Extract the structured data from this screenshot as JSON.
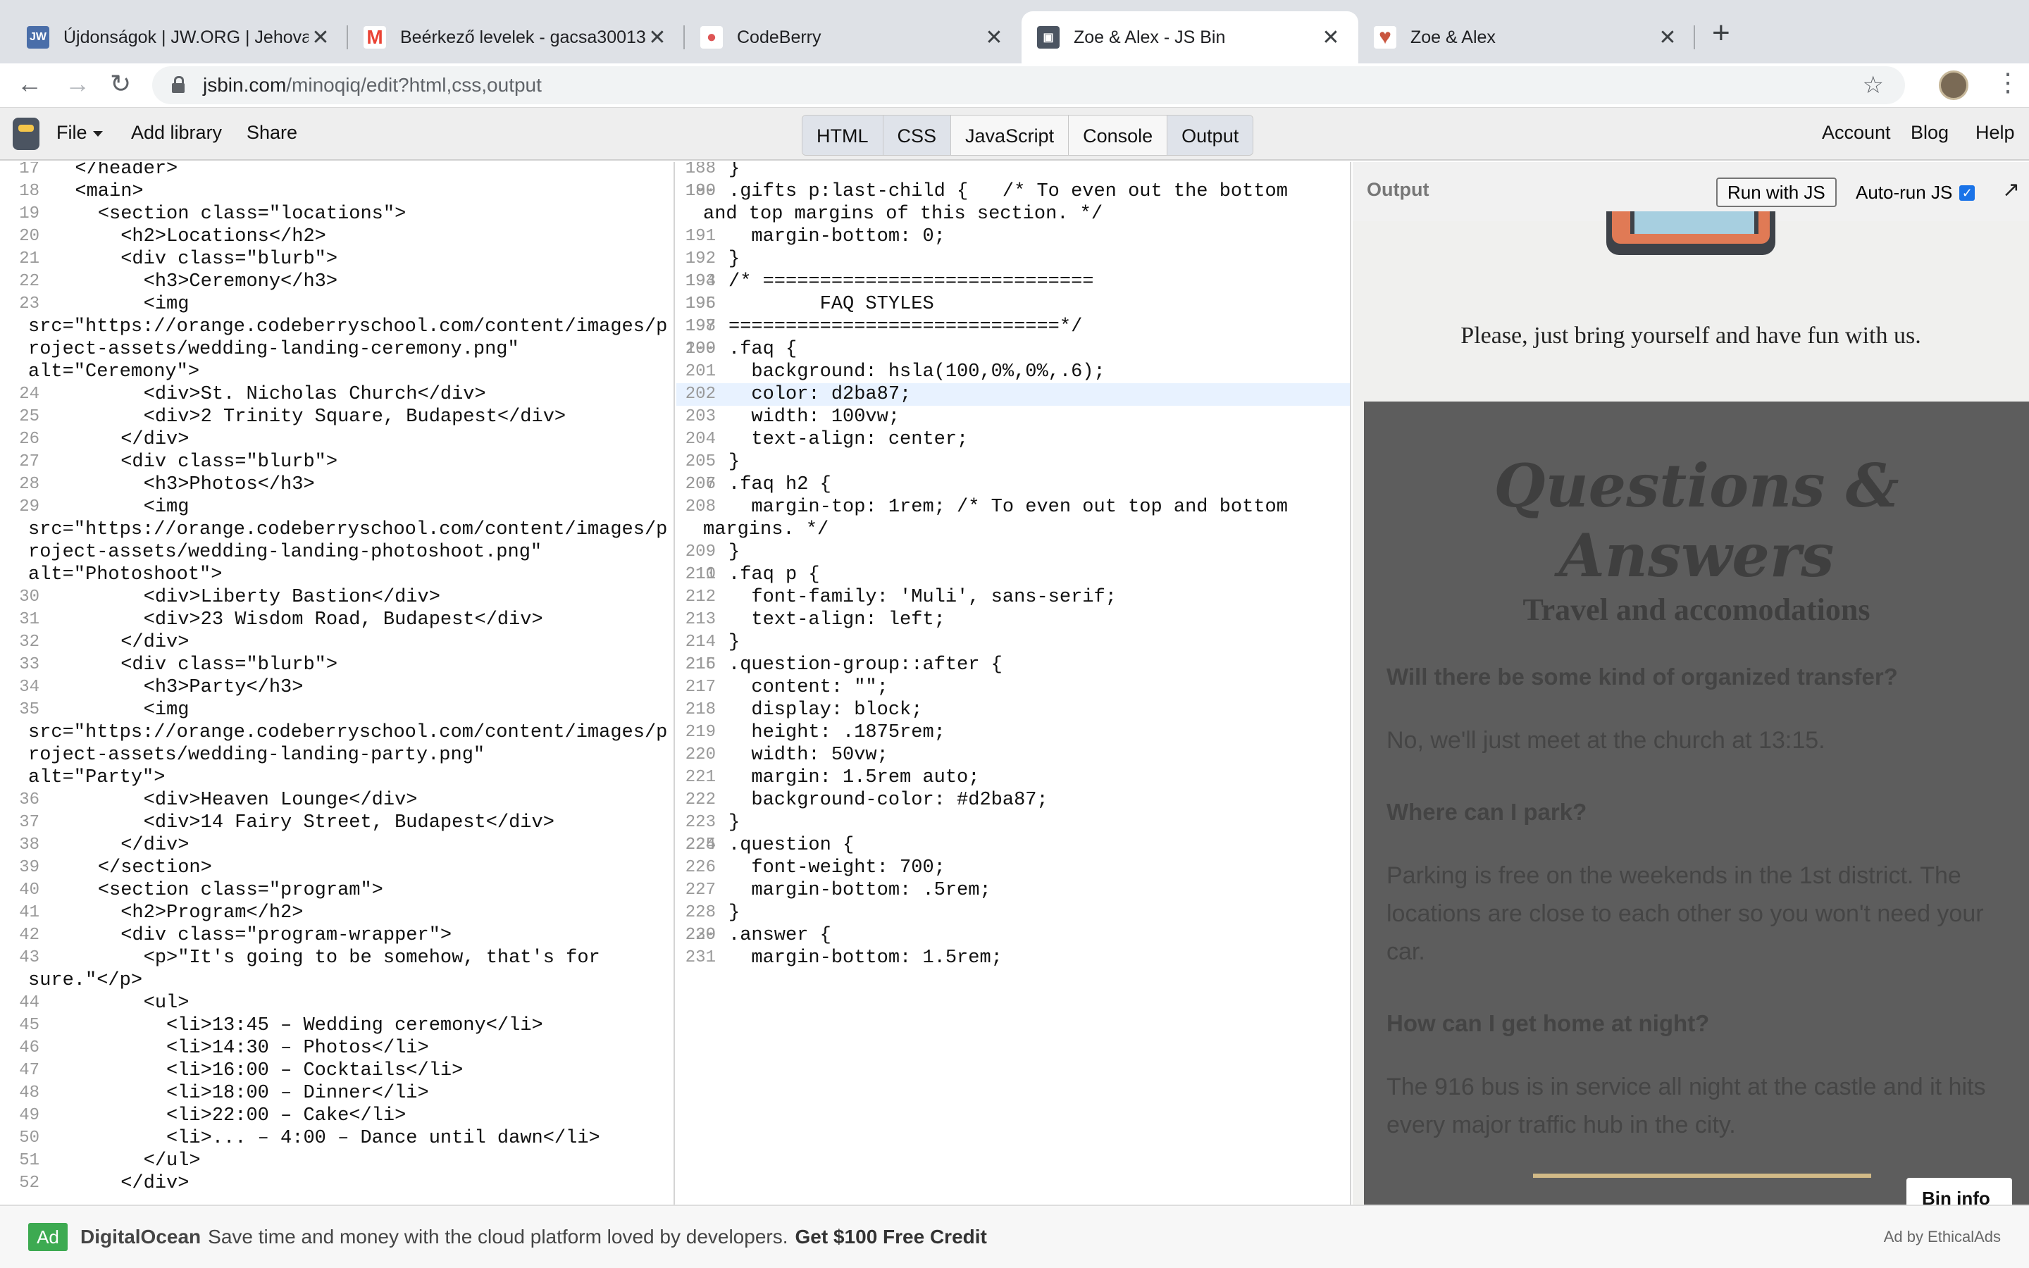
{
  "tabs": [
    {
      "title": "Újdonságok | JW.ORG | Jehova",
      "favicon": "JW",
      "color": "#4a6ea9"
    },
    {
      "title": "Beérkező levelek - gacsa30013",
      "favicon": "M",
      "color": "#ea4335"
    },
    {
      "title": "CodeBerry",
      "favicon": "●",
      "color": "#d55"
    },
    {
      "title": "Zoe & Alex - JS Bin",
      "favicon": "▣",
      "color": "#4b5461"
    },
    {
      "title": "Zoe & Alex",
      "favicon": "♥",
      "color": "#c9553f"
    }
  ],
  "omnibox": {
    "host": "jsbin.com",
    "path": "/minoqiq/edit?html,css,output"
  },
  "jsbin": {
    "menu": {
      "file": "File",
      "add_library": "Add library",
      "share": "Share"
    },
    "panels": [
      "HTML",
      "CSS",
      "JavaScript",
      "Console",
      "Output"
    ],
    "right": {
      "account": "Account",
      "blog": "Blog",
      "help": "Help"
    }
  },
  "html_lines": [
    {
      "n": "17",
      "t": "  </header>"
    },
    {
      "n": "18",
      "t": "  <main>"
    },
    {
      "n": "19",
      "t": "    <section class=\"locations\">"
    },
    {
      "n": "20",
      "t": "      <h2>Locations</h2>"
    },
    {
      "n": "21",
      "t": "      <div class=\"blurb\">"
    },
    {
      "n": "22",
      "t": "        <h3>Ceremony</h3>"
    },
    {
      "n": "23",
      "t": "        <img\nsrc=\"https://orange.codeberryschool.com/content/images/project-assets/wedding-landing-ceremony.png\"\nalt=\"Ceremony\">",
      "wrap": true
    },
    {
      "n": "24",
      "t": "        <div>St. Nicholas Church</div>"
    },
    {
      "n": "25",
      "t": "        <div>2 Trinity Square, Budapest</div>"
    },
    {
      "n": "26",
      "t": "      </div>"
    },
    {
      "n": "27",
      "t": "      <div class=\"blurb\">"
    },
    {
      "n": "28",
      "t": "        <h3>Photos</h3>"
    },
    {
      "n": "29",
      "t": "        <img\nsrc=\"https://orange.codeberryschool.com/content/images/project-assets/wedding-landing-photoshoot.png\"\nalt=\"Photoshoot\">",
      "wrap": true
    },
    {
      "n": "30",
      "t": "        <div>Liberty Bastion</div>"
    },
    {
      "n": "31",
      "t": "        <div>23 Wisdom Road, Budapest</div>"
    },
    {
      "n": "32",
      "t": "      </div>"
    },
    {
      "n": "33",
      "t": "      <div class=\"blurb\">"
    },
    {
      "n": "34",
      "t": "        <h3>Party</h3>"
    },
    {
      "n": "35",
      "t": "        <img\nsrc=\"https://orange.codeberryschool.com/content/images/project-assets/wedding-landing-party.png\"\nalt=\"Party\">",
      "wrap": true
    },
    {
      "n": "36",
      "t": "        <div>Heaven Lounge</div>"
    },
    {
      "n": "37",
      "t": "        <div>14 Fairy Street, Budapest</div>"
    },
    {
      "n": "38",
      "t": "      </div>"
    },
    {
      "n": "39",
      "t": "    </section>"
    },
    {
      "n": "40",
      "t": "    <section class=\"program\">"
    },
    {
      "n": "41",
      "t": "      <h2>Program</h2>"
    },
    {
      "n": "42",
      "t": "      <div class=\"program-wrapper\">"
    },
    {
      "n": "43",
      "t": "        <p>\"It's going to be somehow, that's for\nsure.\"</p>",
      "wrap": true
    },
    {
      "n": "44",
      "t": "        <ul>"
    },
    {
      "n": "45",
      "t": "          <li>13:45 – Wedding ceremony</li>"
    },
    {
      "n": "46",
      "t": "          <li>14:30 – Photos</li>"
    },
    {
      "n": "47",
      "t": "          <li>16:00 – Cocktails</li>"
    },
    {
      "n": "48",
      "t": "          <li>18:00 – Dinner</li>"
    },
    {
      "n": "49",
      "t": "          <li>22:00 – Cake</li>"
    },
    {
      "n": "50",
      "t": "          <li>... – 4:00 – Dance until dawn</li>"
    },
    {
      "n": "51",
      "t": "        </ul>"
    },
    {
      "n": "52",
      "t": "      </div>"
    }
  ],
  "css_lines": [
    {
      "n": "188",
      "t": "}"
    },
    {
      "n": "189",
      "t": ""
    },
    {
      "n": "190",
      "t": ".gifts p:last-child {   /* To even out the bottom\nand top margins of this section. */",
      "wrap": true
    },
    {
      "n": "191",
      "t": "  margin-bottom: 0;"
    },
    {
      "n": "192",
      "t": "}"
    },
    {
      "n": "193",
      "t": ""
    },
    {
      "n": "194",
      "t": "/* ============================="
    },
    {
      "n": "195",
      "t": ""
    },
    {
      "n": "196",
      "t": "        FAQ STYLES"
    },
    {
      "n": "197",
      "t": ""
    },
    {
      "n": "198",
      "t": "=============================*/"
    },
    {
      "n": "199",
      "t": ""
    },
    {
      "n": "200",
      "t": ".faq {"
    },
    {
      "n": "201",
      "t": "  background: hsla(100,0%,0%,.6);"
    },
    {
      "n": "202",
      "t": "  color: d2ba87;",
      "active": true
    },
    {
      "n": "203",
      "t": "  width: 100vw;"
    },
    {
      "n": "204",
      "t": "  text-align: center;"
    },
    {
      "n": "205",
      "t": "}"
    },
    {
      "n": "206",
      "t": ""
    },
    {
      "n": "207",
      "t": ".faq h2 {"
    },
    {
      "n": "208",
      "t": "  margin-top: 1rem; /* To even out top and bottom\nmargins. */",
      "wrap": true
    },
    {
      "n": "209",
      "t": "}"
    },
    {
      "n": "210",
      "t": ""
    },
    {
      "n": "211",
      "t": ".faq p {"
    },
    {
      "n": "212",
      "t": "  font-family: 'Muli', sans-serif;"
    },
    {
      "n": "213",
      "t": "  text-align: left;"
    },
    {
      "n": "214",
      "t": "}"
    },
    {
      "n": "215",
      "t": ""
    },
    {
      "n": "216",
      "t": ".question-group::after {"
    },
    {
      "n": "217",
      "t": "  content: \"\";"
    },
    {
      "n": "218",
      "t": "  display: block;"
    },
    {
      "n": "219",
      "t": "  height: .1875rem;"
    },
    {
      "n": "220",
      "t": "  width: 50vw;"
    },
    {
      "n": "221",
      "t": "  margin: 1.5rem auto;"
    },
    {
      "n": "222",
      "t": "  background-color: #d2ba87;"
    },
    {
      "n": "223",
      "t": "}"
    },
    {
      "n": "224",
      "t": ""
    },
    {
      "n": "225",
      "t": ".question {"
    },
    {
      "n": "226",
      "t": "  font-weight: 700;"
    },
    {
      "n": "227",
      "t": "  margin-bottom: .5rem;"
    },
    {
      "n": "228",
      "t": "}"
    },
    {
      "n": "229",
      "t": ""
    },
    {
      "n": "230",
      "t": ".answer {"
    },
    {
      "n": "231",
      "t": "  margin-bottom: 1.5rem;"
    }
  ],
  "output": {
    "label": "Output",
    "run_button": "Run with JS",
    "autorun_label": "Auto-run JS",
    "autorun_checked": true,
    "bring_text": "Please, just bring yourself and have fun with us.",
    "faq_title": "Questions & Answers",
    "faq_subtitle": "Travel and accomodations",
    "qa": [
      {
        "q": "Will there be some kind of organized transfer?",
        "a": "No, we'll just meet at the church at 13:15."
      },
      {
        "q": "Where can I park?",
        "a": "Parking is free on the weekends in the 1st district. The locations are close to each other so you won't need your car."
      },
      {
        "q": "How can I get home at night?",
        "a": "The 916 bus is in service all night at the castle and it hits every major traffic hub in the city."
      }
    ],
    "bin_info": "Bin info"
  },
  "ad": {
    "badge": "Ad",
    "brand": "DigitalOcean",
    "message": "Save time and money with the cloud platform loved by developers.",
    "cta": "Get $100 Free Credit",
    "by": "Ad by EthicalAds"
  },
  "colors": {
    "accent_gold": "#d2ba87",
    "faq_bg": "#5d5d5d",
    "ad_green": "#3daa51"
  }
}
